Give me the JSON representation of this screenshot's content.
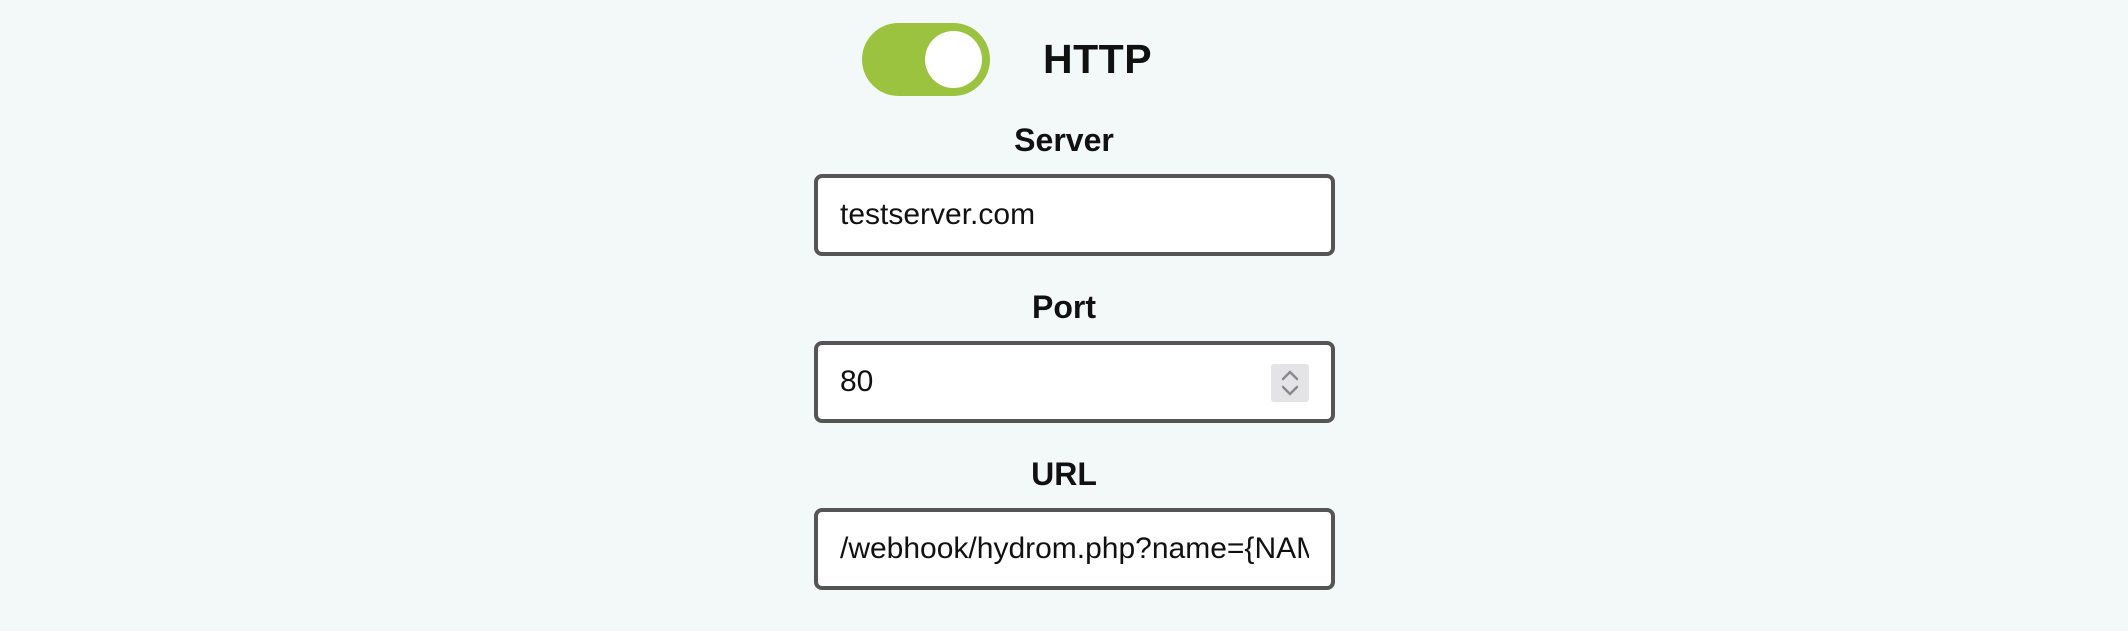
{
  "toggle": {
    "label": "HTTP",
    "state": "on",
    "on_color": "#9bc33f"
  },
  "server": {
    "label": "Server",
    "value": "testserver.com"
  },
  "port": {
    "label": "Port",
    "value": "80"
  },
  "url": {
    "label": "URL",
    "value": "/webhook/hydrom.php?name={NAM"
  },
  "icons": {
    "stepper": "chevron-up-down-icon"
  }
}
